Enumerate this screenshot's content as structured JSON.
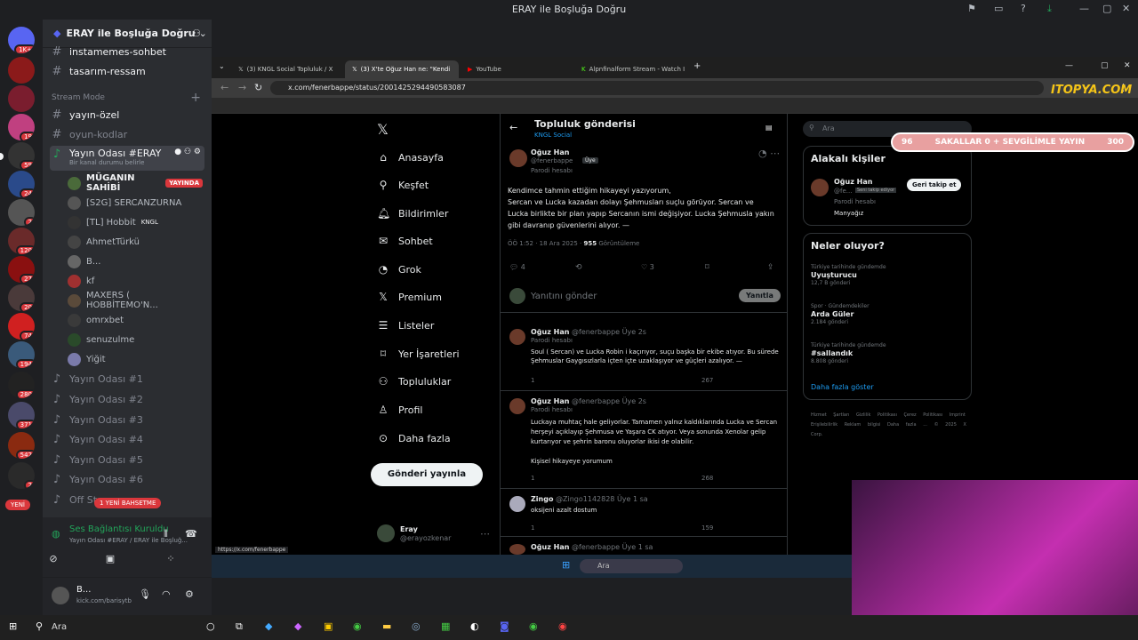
{
  "window_title": "ERAY ile Boşluğa Doğru",
  "server": {
    "name": "ERAY ile Boşluğa Doğru",
    "badge_top": "1K+",
    "badges": [
      "1K+",
      "",
      "",
      "19",
      "59",
      "24",
      "2",
      "120",
      "27",
      "20",
      "74",
      "194",
      "280",
      "371",
      "542",
      "2",
      "YENİ"
    ]
  },
  "channels": {
    "items": [
      {
        "label": "instamemes-sohbet",
        "type": "text"
      },
      {
        "label": "tasarım-ressam",
        "type": "text"
      },
      {
        "label": "Stream Mode",
        "type": "header"
      },
      {
        "label": "yayın-özel",
        "type": "text"
      },
      {
        "label": "oyun-kodlar",
        "type": "text"
      },
      {
        "label": "Yayın Odası #ERAY",
        "type": "voice",
        "status": "Bir kanal durumu belirle"
      }
    ],
    "voice_users": [
      "MÜGANIN SAHİBİ",
      "[S2G] SERCANZURNA",
      "[TL] Hobbit",
      "AhmetTürkü",
      "B...",
      "kf",
      "MAXERS ( HOBBİTEMO'N...",
      "omrxbet",
      "senuzulme",
      "Yiğit"
    ],
    "live_badge": "YAYINDA",
    "kngl_tag": "KNGL",
    "voice_rooms": [
      "Yayın Odası #1",
      "Yayın Odası #2",
      "Yayın Odası #3",
      "Yayın Odası #4",
      "Yayın Odası #5",
      "Yayın Odası #6",
      "Off St"
    ],
    "new_mention": "1 YENİ BAHSETME"
  },
  "voice_panel": {
    "status": "Ses Bağlantısı Kuruldu",
    "sub": "Yayın Odası #ERAY / ERAY ile Boşluğ..."
  },
  "user_panel": {
    "name": "B...",
    "sub": "kick.com/barisytb"
  },
  "browser": {
    "tabs": [
      "(3) KNGL Social Topluluk / X",
      "(3) X'te Oğuz Han ne: \"Kendim",
      "YouTube",
      "Alpnfinalform Stream - Watch I"
    ],
    "url": "x.com/fenerbappe/status/2001425294490583087",
    "status_url": "https://x.com/fenerbappe"
  },
  "x": {
    "nav": [
      "Anasayfa",
      "Keşfet",
      "Bildirimler",
      "Sohbet",
      "Grok",
      "Premium",
      "Listeler",
      "Yer İşaretleri",
      "Topluluklar",
      "Profil",
      "Daha fazla"
    ],
    "post_button": "Gönderi yayınla",
    "me": {
      "name": "Eray",
      "handle": "@erayozkenar"
    },
    "header": {
      "title": "Topluluk gönderisi",
      "sub": "KNGL Social"
    },
    "main": {
      "name": "Oğuz Han",
      "handle": "@fenerbappe",
      "role": "Üye",
      "parody": "Parodi hesabı",
      "text": "Kendimce tahmin ettiğim hikayeyi yazıyorum,\nSercan ve Lucka kazadan dolayı Şehmusları suçlu görüyor. Sercan ve Lucka birlikte bir plan yapıp Sercanın ismi değişiyor. Lucka Şehmusla yakın gibi davranıp güvenlerini alıyor. —",
      "time": "ÖÖ 1:52 · 18 Ara 2025 ·",
      "views": "955",
      "views_label": "Görüntüleme",
      "replies": "4",
      "likes": "3"
    },
    "reply_placeholder": "Yanıtını gönder",
    "reply_button": "Yanıtla",
    "replies": [
      {
        "name": "Oğuz Han",
        "handle": "@fenerbappe",
        "role": "Üye",
        "time": "2s",
        "parody": "Parodi hesabı",
        "text": "Soul ( Sercan) ve Lucka Robin i kaçırıyor, suçu başka bir ekibe atıyor. Bu sürede Şehmuslar Gaygısızlarla içten içte uzaklaşıyor ve güçleri azalıyor. —",
        "r": "1",
        "v": "267"
      },
      {
        "name": "Oğuz Han",
        "handle": "@fenerbappe",
        "role": "Üye",
        "time": "2s",
        "parody": "Parodi hesabı",
        "text": "Luckaya muhtaç hale geliyorlar. Tamamen yalnız kaldıklarında Lucka ve Sercan herşeyi açıklayıp Şehmusa ve Yaşara CK atıyor. Veya sonunda Xenolar gelip kurtarıyor ve şehrin baronu oluyorlar ikisi de olabilir.\n\nKişisel hikayeye yorumum",
        "r": "1",
        "v": "268"
      },
      {
        "name": "Zingo",
        "handle": "@Zingo1142828",
        "role": "Üye",
        "time": "1 sa",
        "parody": "",
        "text": "oksijeni azalt dostum",
        "r": "1",
        "v": "159"
      },
      {
        "name": "Oğuz Han",
        "handle": "@fenerbappe",
        "role": "Üye",
        "time": "1 sa",
        "parody": "",
        "text": "",
        "r": "",
        "v": ""
      }
    ],
    "search_placeholder": "Ara",
    "related": {
      "title": "Alakalı kişiler",
      "name": "Oğuz Han",
      "handle": "@fe...",
      "follows": "Seni takip ediyor",
      "parody": "Parodi hesabı",
      "bio": "Manyağız",
      "button": "Geri takip et"
    },
    "trends": {
      "title": "Neler oluyor?",
      "items": [
        {
          "ctx": "Türkiye tarihinde gündemde",
          "name": "Uyuşturucu",
          "count": "12,7 B gönderi"
        },
        {
          "ctx": "Spor · Gündemdekiler",
          "name": "Arda Güler",
          "count": "2.184 gönderi"
        },
        {
          "ctx": "Türkiye tarihinde gündemde",
          "name": "#sallandık",
          "count": "8.808 gönderi"
        }
      ],
      "more": "Daha fazla göster"
    },
    "footer": [
      "Hizmet Şartları",
      "Gizlilik Politikası",
      "Çerez Politikası",
      "Imprint",
      "Erişilebilirlik",
      "Reklam bilgisi",
      "Daha fazla ...",
      "© 2025 X Corp."
    ]
  },
  "overlay": {
    "left": "96",
    "text": "SAKALLAR 0 + SEVGİLİMLE YAYIN",
    "right": "300",
    "logo": "ITOPYA.COM"
  },
  "windows_task": {
    "search": "Ara"
  },
  "taskbar": {
    "search": "Ara"
  }
}
